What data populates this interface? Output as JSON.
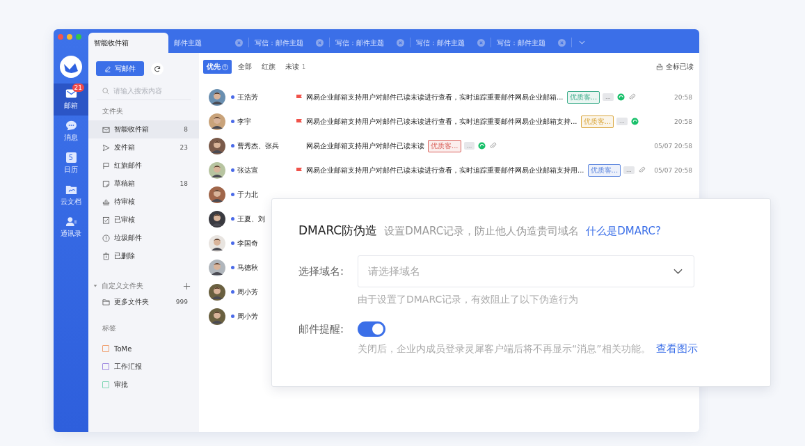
{
  "rail": {
    "items": [
      {
        "label": "邮箱",
        "kind": "mail",
        "selected": true,
        "badge": "21"
      },
      {
        "label": "消息",
        "kind": "chat",
        "selected": false
      },
      {
        "label": "日历",
        "kind": "calendar",
        "selected": false,
        "icon_text": "5"
      },
      {
        "label": "云文档",
        "kind": "cloud-folder",
        "selected": false
      },
      {
        "label": "通讯录",
        "kind": "contact",
        "selected": false
      }
    ]
  },
  "tabs": [
    {
      "label": "智能收件箱",
      "selected": true,
      "closable": false
    },
    {
      "label": "邮件主题",
      "selected": false,
      "closable": true
    },
    {
      "label": "写信：邮件主题",
      "selected": false,
      "closable": true
    },
    {
      "label": "写信：邮件主题",
      "selected": false,
      "closable": true
    },
    {
      "label": "写信：邮件主题",
      "selected": false,
      "closable": true
    },
    {
      "label": "写信：邮件主题",
      "selected": false,
      "closable": true
    }
  ],
  "sidebar": {
    "compose_button": "写邮件",
    "search": {
      "placeholder": "请输入搜索内容"
    },
    "folders_heading": "文件夹",
    "folders": [
      {
        "label": "智能收件箱",
        "kind": "inbox",
        "count": "8",
        "selected": true
      },
      {
        "label": "发件箱",
        "kind": "sent",
        "count": "23",
        "selected": false
      },
      {
        "label": "红旗邮件",
        "kind": "flag",
        "selected": false
      },
      {
        "label": "草稿箱",
        "kind": "draft",
        "count": "18",
        "selected": false
      },
      {
        "label": "待审核",
        "kind": "stamp",
        "selected": false
      },
      {
        "label": "已审核",
        "kind": "check",
        "selected": false
      },
      {
        "label": "垃圾邮件",
        "kind": "spam",
        "selected": false
      },
      {
        "label": "已删除",
        "kind": "trash",
        "selected": false
      }
    ],
    "custom_heading": "自定义文件夹",
    "custom_expanded": true,
    "custom_folders": [
      {
        "label": "更多文件夹",
        "count": "999",
        "selected": false
      }
    ],
    "tags_heading": "标签",
    "tags": [
      {
        "label": "ToMe",
        "color": "#f0a070"
      },
      {
        "label": "工作汇报",
        "color": "#a08ce0"
      },
      {
        "label": "审批",
        "color": "#7fd6b4"
      }
    ]
  },
  "filters": [
    {
      "label": "优先",
      "selected": true,
      "help": true
    },
    {
      "label": "全部",
      "selected": false
    },
    {
      "label": "红旗",
      "selected": false
    },
    {
      "label": "未读",
      "selected": false,
      "count": "1"
    }
  ],
  "mark_all_read": "全标已读",
  "mails": [
    {
      "name": "王浩芳",
      "unread": true,
      "flagged": true,
      "subject": "网易企业邮箱支持用户对邮件已读未读进行查看，实时追踪重要邮件网易企业邮箱...",
      "tag": {
        "text": "优质客...",
        "color": "#3fae8c"
      },
      "more": "...",
      "wechat": true,
      "attachment": true,
      "time": "20:58"
    },
    {
      "name": "李宇",
      "unread": true,
      "flagged": true,
      "subject": "网易企业邮箱支持用户对邮件已读未读进行查看，实时追踪重要邮件网易企业邮箱支持...",
      "tag": {
        "text": "优质客...",
        "color": "#d9a53a"
      },
      "more": "...",
      "wechat": true,
      "attachment": false,
      "time": "20:58"
    },
    {
      "name": "曹秀杰、张兵",
      "unread": true,
      "flagged": false,
      "subject": "网易企业邮箱支持用户对邮件已读未读",
      "tag": {
        "text": "优质客...",
        "color": "#d9605a"
      },
      "more": "...",
      "wechat": true,
      "attachment": true,
      "time": "05/07 20:58"
    },
    {
      "name": "张达宣",
      "unread": true,
      "flagged": true,
      "subject": "网易企业邮箱支持用户对邮件已读未读进行查看，实时追踪重要邮件网易企业邮箱支持用...",
      "tag": {
        "text": "优质客...",
        "color": "#5a84dd"
      },
      "more": "...",
      "wechat": false,
      "attachment": true,
      "time": "05/07 20:58"
    },
    {
      "name": "于力北",
      "unread": true
    },
    {
      "name": "王夏、刘",
      "unread": true
    },
    {
      "name": "李国奇",
      "unread": true
    },
    {
      "name": "马德秋",
      "unread": true
    },
    {
      "name": "周小芳",
      "unread": true
    },
    {
      "name": "周小芳",
      "unread": true
    }
  ],
  "dmarc_panel": {
    "title": "DMARC防伪造",
    "description": "设置DMARC记录，防止他人伪造贵司域名",
    "help_link": "什么是DMARC?",
    "domain_label": "选择域名:",
    "domain_select": {
      "placeholder": "请选择域名"
    },
    "domain_hint": "由于设置了DMARC记录，有效阻止了以下伪造行为",
    "notify_label": "邮件提醒:",
    "notify_toggle": {
      "on": true
    },
    "notify_hint": "关闭后，企业内成员登录灵犀客户端后将不再显示“消息”相关功能。",
    "notify_link": "查看图示"
  }
}
